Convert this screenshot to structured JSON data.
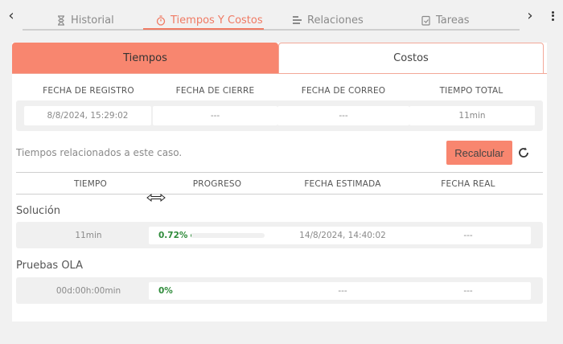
{
  "top_tabs": [
    {
      "label": "Historial",
      "icon": "hourglass-icon"
    },
    {
      "label": "Tiempos Y Costos",
      "icon": "timer-icon",
      "active": true
    },
    {
      "label": "Relaciones",
      "icon": "relations-icon"
    },
    {
      "label": "Tareas",
      "icon": "tasks-icon"
    }
  ],
  "sub_tabs": {
    "tiempos": "Tiempos",
    "costos": "Costos"
  },
  "summary": {
    "headers": [
      "FECHA DE REGISTRO",
      "FECHA DE CIERRE",
      "FECHA DE CORREO",
      "TIEMPO TOTAL"
    ],
    "values": [
      "8/8/2024, 15:29:02",
      "---",
      "---",
      "11min"
    ]
  },
  "related_note": "Tiempos relacionados a este caso.",
  "recalc_label": "Recalcular",
  "detail_headers": [
    "TIEMPO",
    "PROGRESO",
    "FECHA ESTIMADA",
    "FECHA REAL"
  ],
  "sections": [
    {
      "title": "Solución",
      "tiempo": "11min",
      "progreso": "0.72%",
      "progress_fraction": 0.0072,
      "fecha_estimada": "14/8/2024, 14:40:02",
      "fecha_real": "---"
    },
    {
      "title": "Pruebas OLA",
      "tiempo": "00d:00h:00min",
      "progreso": "0%",
      "progress_fraction": 0,
      "fecha_estimada": "---",
      "fecha_real": "---"
    }
  ],
  "colors": {
    "accent": "#f8866f",
    "accent_text": "#f07a63",
    "progress": "#2e8b3a"
  }
}
